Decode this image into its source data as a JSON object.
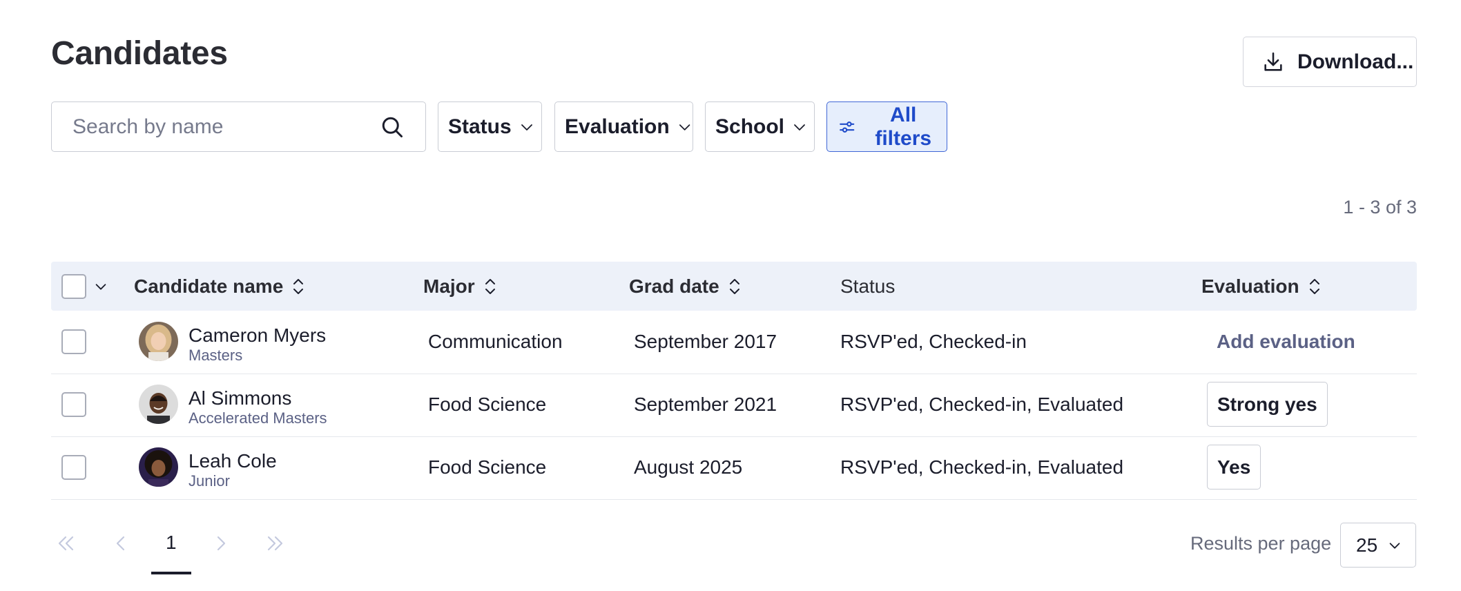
{
  "page": {
    "title": "Candidates"
  },
  "toolbar": {
    "download_label": "Download..."
  },
  "search": {
    "placeholder": "Search by name"
  },
  "filters": {
    "status": "Status",
    "evaluation": "Evaluation",
    "school": "School",
    "all": "All filters"
  },
  "results": {
    "count_text": "1 - 3 of 3"
  },
  "table": {
    "columns": [
      "Candidate name",
      "Major",
      "Grad date",
      "Status",
      "Evaluation"
    ],
    "rows": [
      {
        "name": "Cameron Myers",
        "level": "Masters",
        "major": "Communication",
        "grad_date": "September 2017",
        "status": "RSVP'ed, Checked-in",
        "evaluation": "Add evaluation"
      },
      {
        "name": "Al Simmons",
        "level": "Accelerated Masters",
        "major": "Food Science",
        "grad_date": "September 2021",
        "status": "RSVP'ed, Checked-in, Evaluated",
        "evaluation": "Strong yes"
      },
      {
        "name": "Leah Cole",
        "level": "Junior",
        "major": "Food Science",
        "grad_date": "August 2025",
        "status": "RSVP'ed, Checked-in, Evaluated",
        "evaluation": "Yes"
      }
    ]
  },
  "pagination": {
    "current_page": "1",
    "results_per_page_label": "Results per page",
    "results_per_page": "25"
  },
  "colors": {
    "accent": "#1f4bc9",
    "accent_bg": "#e6eefc",
    "header_bg": "#edf1f9",
    "muted": "#5b6185"
  }
}
